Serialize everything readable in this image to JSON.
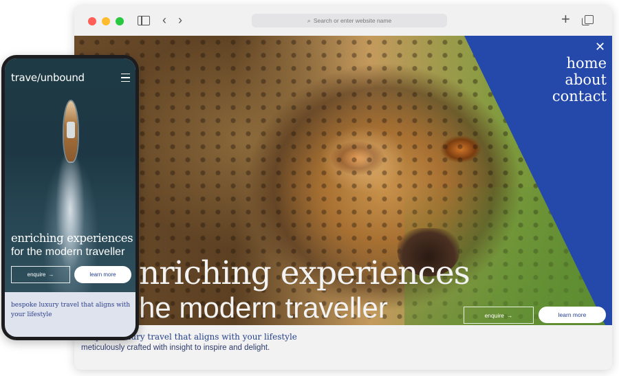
{
  "browser": {
    "address_placeholder": "Search or enter website name",
    "icons": [
      "close-window",
      "minimize-window",
      "zoom-window",
      "sidebar-icon",
      "back-icon",
      "forward-icon",
      "search-icon",
      "new-tab-icon",
      "tabs-overview-icon"
    ]
  },
  "desktop": {
    "nav": {
      "home": "home",
      "about": "about",
      "contact": "contact"
    },
    "headline_line1": "nriching experiences",
    "headline_line2": "he modern traveller",
    "enquire_label": "enquire",
    "learn_more_label": "learn more",
    "subline1": "bespoke luxury travel that aligns with your lifestyle",
    "subline2": "meticulously crafted with insight to inspire and delight.",
    "accent_color": "#2548ab"
  },
  "mobile": {
    "logo": "trave/unbound",
    "headline_line1": "enriching experiences",
    "headline_line2": "for the modern traveller",
    "enquire_label": "enquire",
    "learn_more_label": "learn more",
    "subline": "bespoke luxury travel that aligns with your lifestyle"
  }
}
